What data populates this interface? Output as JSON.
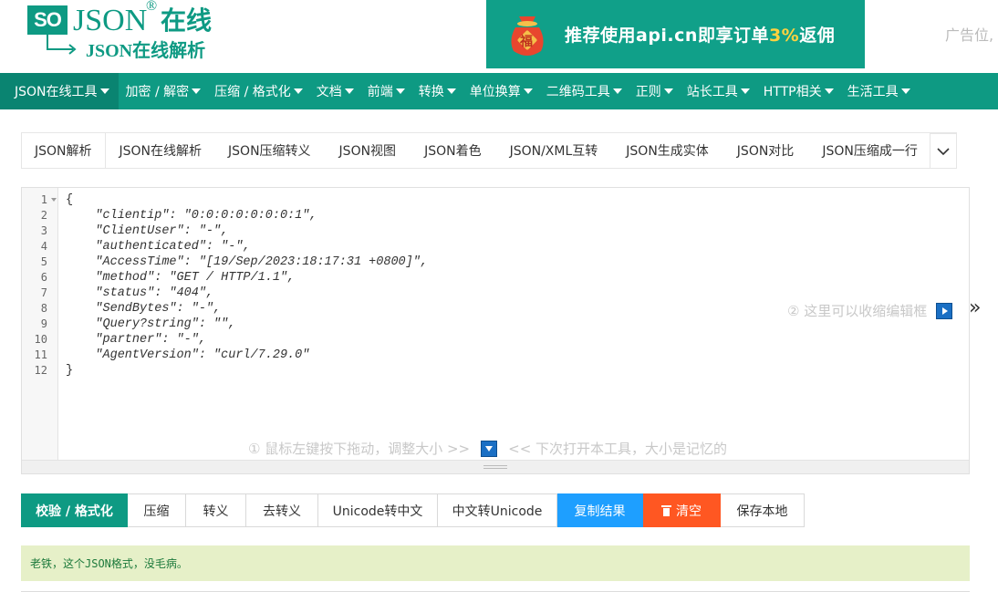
{
  "header": {
    "logo_box": "SO",
    "logo_json": "JSON",
    "logo_reg": "®",
    "logo_zx": "在线",
    "logo_sub": "JSON在线解析",
    "banner": {
      "text_pre": "推荐使用api.cn即享订单",
      "text_hl": "3%",
      "text_post": "返佣",
      "bag_char": "福"
    },
    "ad_text": "广告位,"
  },
  "nav": {
    "items": [
      {
        "label": "JSON在线工具"
      },
      {
        "label": "加密 / 解密"
      },
      {
        "label": "压缩 / 格式化"
      },
      {
        "label": "文档"
      },
      {
        "label": "前端"
      },
      {
        "label": "转换"
      },
      {
        "label": "单位换算"
      },
      {
        "label": "二维码工具"
      },
      {
        "label": "正则"
      },
      {
        "label": "站长工具"
      },
      {
        "label": "HTTP相关"
      },
      {
        "label": "生活工具"
      }
    ]
  },
  "tabs": [
    {
      "label": "JSON解析"
    },
    {
      "label": "JSON在线解析"
    },
    {
      "label": "JSON压缩转义"
    },
    {
      "label": "JSON视图"
    },
    {
      "label": "JSON着色"
    },
    {
      "label": "JSON/XML互转"
    },
    {
      "label": "JSON生成实体"
    },
    {
      "label": "JSON对比"
    },
    {
      "label": "JSON压缩成一行"
    }
  ],
  "editor": {
    "line_numbers": [
      "1",
      "2",
      "3",
      "4",
      "5",
      "6",
      "7",
      "8",
      "9",
      "10",
      "11",
      "12"
    ],
    "lines": [
      "{",
      "    \"clientip\": \"0:0:0:0:0:0:0:1\",",
      "    \"ClientUser\": \"-\",",
      "    \"authenticated\": \"-\",",
      "    \"AccessTime\": \"[19/Sep/2023:18:17:31 +0800]\",",
      "    \"method\": \"GET / HTTP/1.1\",",
      "    \"status\": \"404\",",
      "    \"SendBytes\": \"-\",",
      "    \"Query?string\": \"\",",
      "    \"partner\": \"-\",",
      "    \"AgentVersion\": \"curl/7.29.0\"",
      "}"
    ],
    "hint_resize_pre": "① 鼠标左键按下拖动，调整大小 >>",
    "hint_resize_post": "<< 下次打开本工具，大小是记忆的",
    "hint_collapse": "② 这里可以收缩编辑框",
    "collapse_arrows": "»"
  },
  "buttons": {
    "validate": "校验 / 格式化",
    "compress": "压缩",
    "escape": "转义",
    "unescape": "去转义",
    "unicode_to_cn": "Unicode转中文",
    "cn_to_unicode": "中文转Unicode",
    "copy": "复制结果",
    "clear": "清空",
    "save": "保存本地"
  },
  "result": {
    "message": "老铁，这个JSON格式，没毛病。"
  }
}
